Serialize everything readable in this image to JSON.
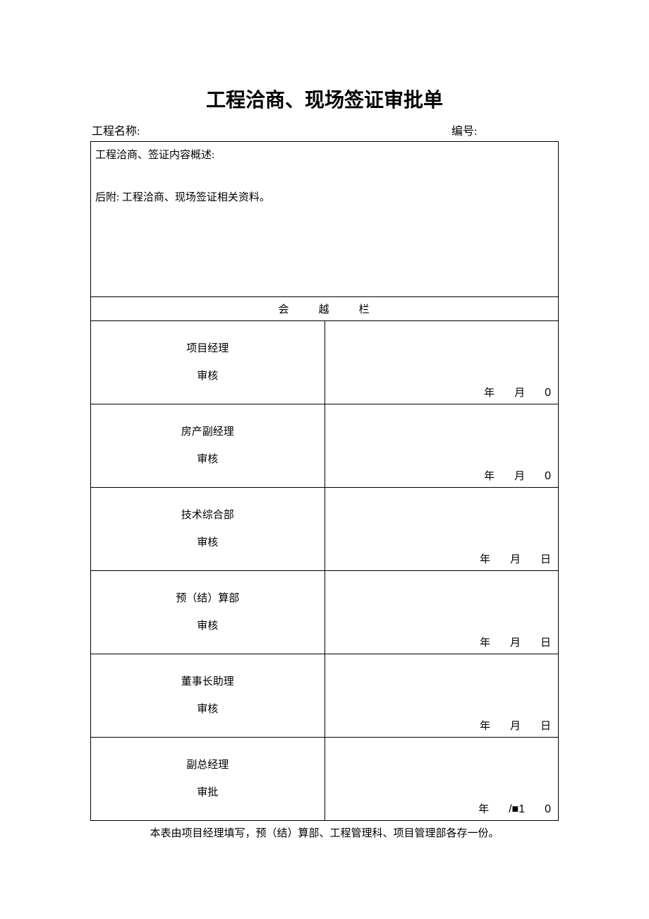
{
  "title": "工程洽商、现场签证审批单",
  "header": {
    "project_label": "工程名称:",
    "number_label": "编号:"
  },
  "description": {
    "line1": "工程洽商、签证内容概述:",
    "line2": "后附: 工程洽商、现场签证相关资料。"
  },
  "section_header": {
    "char1": "会",
    "char2": "越",
    "char3": "栏"
  },
  "rows": [
    {
      "role": "项目经理",
      "action": "审核",
      "y": "年",
      "m": "月",
      "d": "0"
    },
    {
      "role": "房产副经理",
      "action": "审核",
      "y": "年",
      "m": "月",
      "d": "0"
    },
    {
      "role": "技术综合部",
      "action": "审核",
      "y": "年",
      "m": "月",
      "d": "日"
    },
    {
      "role": "预（结）算部",
      "action": "审核",
      "y": "年",
      "m": "月",
      "d": "日"
    },
    {
      "role": "董事长助理",
      "action": "审核",
      "y": "年",
      "m": "月",
      "d": "日"
    },
    {
      "role": "副总经理",
      "action": "审批",
      "y": "年",
      "m": "/■1",
      "d": "0"
    }
  ],
  "footer": "本表由项目经理填写，预（结）算部、工程管理科、项目管理部各存一份。"
}
